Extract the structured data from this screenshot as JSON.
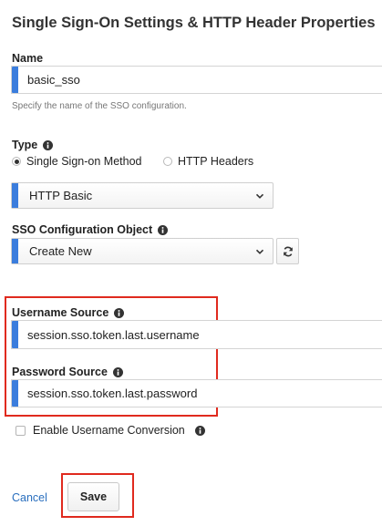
{
  "header": {
    "title": "Single Sign-On Settings & HTTP Header Properties"
  },
  "name_field": {
    "label": "Name",
    "value": "basic_sso",
    "help": "Specify the name of the SSO configuration."
  },
  "type_field": {
    "label": "Type",
    "options": [
      {
        "label": "Single Sign-on Method",
        "selected": true
      },
      {
        "label": "HTTP Headers",
        "selected": false
      }
    ]
  },
  "method_select": {
    "value": "HTTP Basic"
  },
  "sso_config_object": {
    "label": "SSO Configuration Object",
    "value": "Create New"
  },
  "username_source": {
    "label": "Username Source",
    "value": "session.sso.token.last.username"
  },
  "password_source": {
    "label": "Password Source",
    "value": "session.sso.token.last.password"
  },
  "username_conversion": {
    "label": "Enable Username Conversion",
    "checked": false
  },
  "actions": {
    "cancel_label": "Cancel",
    "save_label": "Save"
  },
  "colors": {
    "accent_bar": "#3b7ddd",
    "highlight": "#e02a1e",
    "link": "#2a6fbe"
  },
  "icons": {
    "info": "info-icon",
    "chevron": "chevron-down-icon",
    "refresh": "refresh-icon"
  }
}
